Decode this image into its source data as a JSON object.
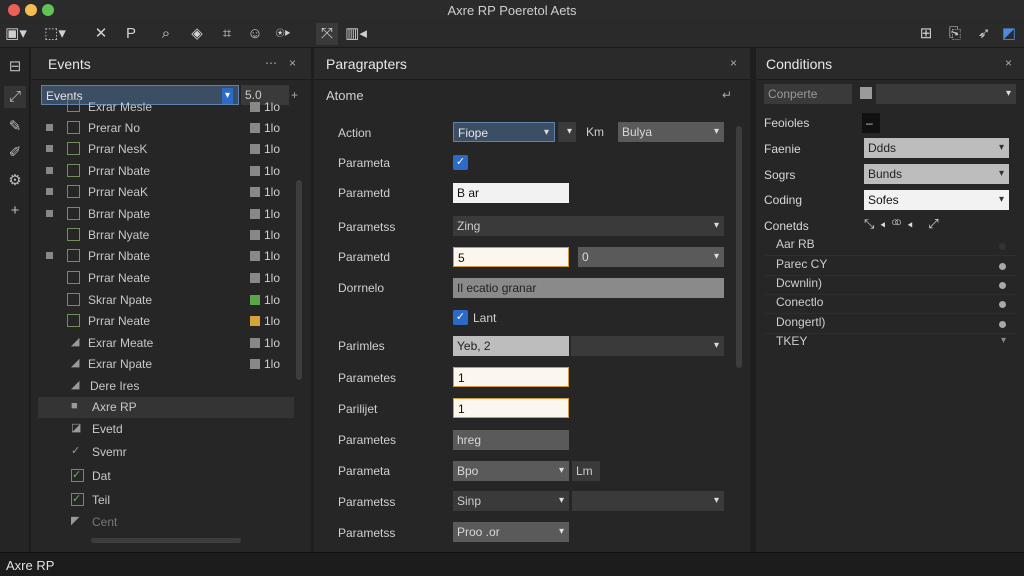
{
  "window": {
    "title": "Axre RP Poeretol Aets"
  },
  "status": {
    "label": "Axre RP"
  },
  "toolbar": {
    "icons": [
      "layout-icon",
      "selection-icon",
      "close-x-icon",
      "pen-icon",
      "search-icon",
      "layers-icon",
      "crop-icon",
      "emoji-icon",
      "play-icon",
      "connector-icon",
      "grid-icon",
      "publish-icon",
      "preview-icon",
      "share-icon",
      "account-icon"
    ]
  },
  "events": {
    "title": "Events",
    "dropdown": "Events",
    "value": "5.0",
    "close": "×",
    "menu": "⋯",
    "add": "+",
    "rows": [
      {
        "label": "Exrar Mesle",
        "val": "1lo"
      },
      {
        "label": "Prerar No",
        "val": "1lo"
      },
      {
        "label": "Prrar NesK",
        "val": "1lo"
      },
      {
        "label": "Prrar Nbate",
        "val": "1lo"
      },
      {
        "label": "Prrar NeaK",
        "val": "1lo"
      },
      {
        "label": "Brrar Npate",
        "val": "1lo"
      },
      {
        "label": "Brrar Nyate",
        "val": "1lo"
      },
      {
        "label": "Prrar Nbate",
        "val": "1lo"
      },
      {
        "label": "Prrar Neate",
        "val": "1lo"
      },
      {
        "label": "Skrar Npate",
        "val": "1lo"
      },
      {
        "label": "Prrar Neate",
        "val": "1lo"
      },
      {
        "label": "Exrar Meate",
        "val": "1lo"
      },
      {
        "label": "Exrar Npate",
        "val": "1lo"
      },
      {
        "label": "Dere Ires",
        "val": ""
      },
      {
        "label": "Axre RP",
        "val": ""
      },
      {
        "label": "Evetd",
        "val": ""
      },
      {
        "label": "Svemr",
        "val": ""
      },
      {
        "label": "Dat",
        "val": ""
      },
      {
        "label": "Teil",
        "val": ""
      },
      {
        "label": "Cent",
        "val": ""
      }
    ]
  },
  "params": {
    "title": "Paragrapters",
    "subtitle": "Atome",
    "close": "×",
    "arrow": "↵",
    "rows": {
      "action_lbl": "Action",
      "action_val": "Fiope",
      "action_unit": "Km",
      "action_sel": "Bulya",
      "p1_lbl": "Parameta",
      "p2_lbl": "Parametd",
      "p2_val": "B ar",
      "p3_lbl": "Parametss",
      "p3_val": "Zing",
      "p4_lbl": "Parametd",
      "p4_val": "5",
      "p4_sel": "0",
      "p5_lbl": "Dorrnelo",
      "p5_val": "Il ecatio granar",
      "cb_lbl": "Lant",
      "p6_lbl": "Parimles",
      "p6_val": "Yeb,  2",
      "p7_lbl": "Parametes",
      "p7_val": "1",
      "p8_lbl": "Parilijet",
      "p8_val": "1",
      "p9_lbl": "Parametes",
      "p9_val": "hreg",
      "p10_lbl": "Parameta",
      "p10_val": "Bpo",
      "p10_unit": "Lm",
      "p11_lbl": "Parametss",
      "p11_val": "Sinp",
      "p12_lbl": "Parametss",
      "p12_val": "Proo .or"
    }
  },
  "conditions": {
    "title": "Conditions",
    "close": "×",
    "search": "Conperte",
    "f1_lbl": "Feoioles",
    "f1_val": "–",
    "f2_lbl": "Faenie",
    "f2_val": "Ddds",
    "f3_lbl": "Sogrs",
    "f3_val": "Bunds",
    "f4_lbl": "Coding",
    "f4_val": "Sofes",
    "f5_lbl": "Conetds",
    "items": [
      "Aar RB",
      "Parec CY",
      "Dcwnlin)",
      "Conectlo",
      "Dongertl)",
      "TKEY"
    ]
  }
}
